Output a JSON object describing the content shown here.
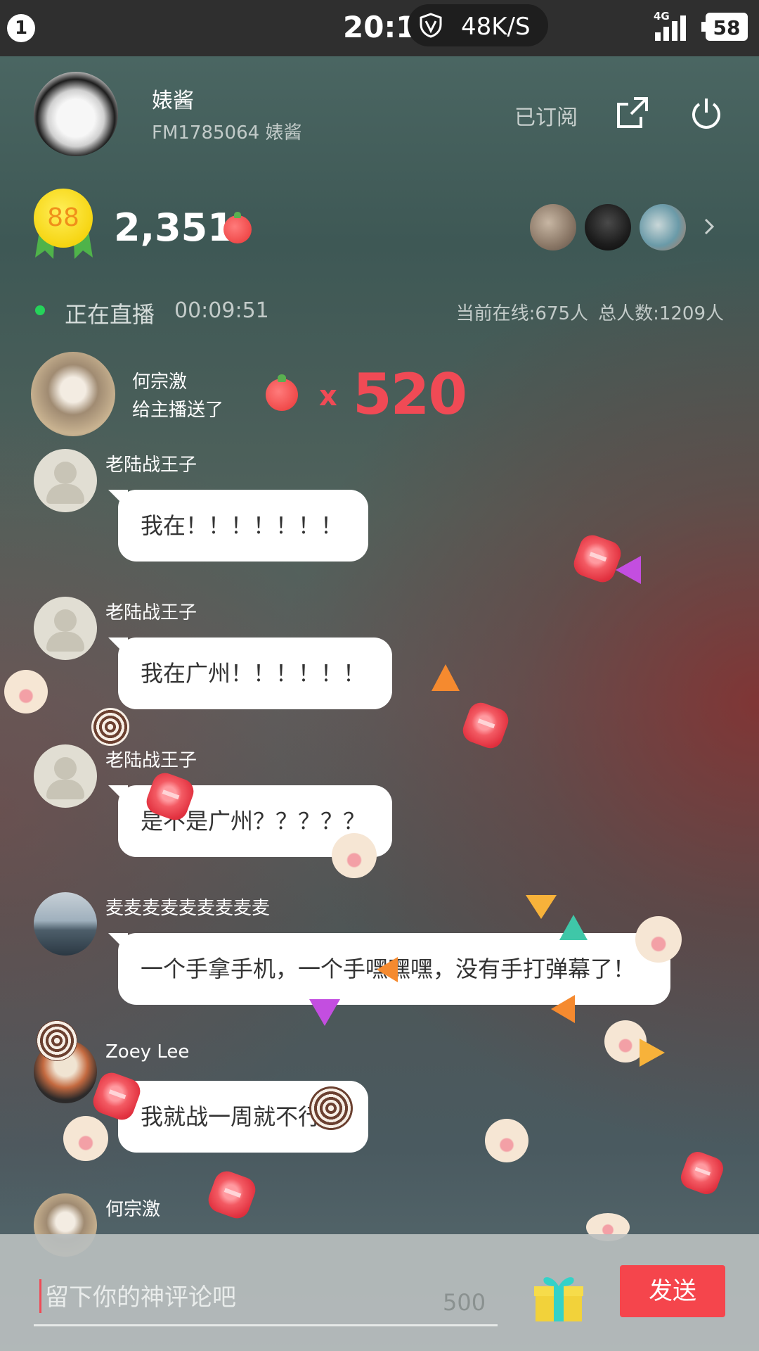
{
  "status_bar": {
    "notification_count": "1",
    "time": "20:11",
    "net_speed": "48K/S",
    "network": "4G",
    "battery": "58"
  },
  "header": {
    "host_name": "婊酱",
    "host_id": "FM1785064 婊酱",
    "subscribe_label": "已订阅",
    "share_icon": "share-icon",
    "power_icon": "power-icon"
  },
  "stats": {
    "level": "88",
    "coins": "2,351"
  },
  "live": {
    "status": "正在直播",
    "duration": "00:09:51",
    "online": "当前在线:675人",
    "total": "总人数:1209人"
  },
  "gift_notice": {
    "user": "何宗激",
    "action": "给主播送了",
    "x": "x",
    "count": "520"
  },
  "messages": [
    {
      "user": "老陆战王子",
      "text": "我在！！！！！！！"
    },
    {
      "user": "老陆战王子",
      "text": "我在广州！！！！！！"
    },
    {
      "user": "老陆战王子",
      "text": "是不是广州？？？？？"
    },
    {
      "user": "麦麦麦麦麦麦麦麦麦",
      "text": "一个手拿手机，一个手嘿嘿嘿，没有手打弹幕了！"
    },
    {
      "user": "Zoey Lee",
      "text": "我就战一周就不行"
    },
    {
      "user": "何宗激",
      "text": ""
    }
  ],
  "input": {
    "placeholder": "留下你的神评论吧",
    "char_limit": "500",
    "send_label": "发送"
  },
  "colors": {
    "accent_red": "#f5454c",
    "live_green": "#25d35a",
    "gift_red": "#f04a55"
  }
}
